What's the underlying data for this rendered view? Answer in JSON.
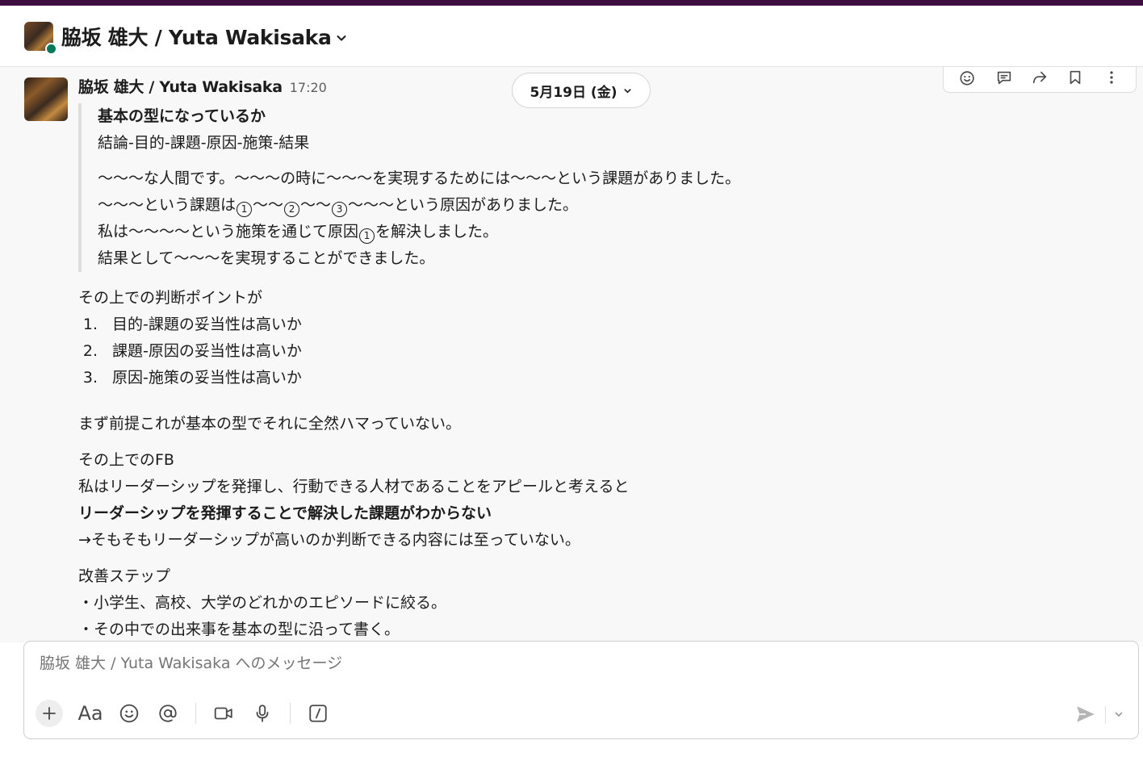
{
  "header": {
    "title": "脇坂 雄大 / Yuta Wakisaka"
  },
  "message": {
    "author": "脇坂 雄大 / Yuta Wakisaka",
    "time": "17:20",
    "quote": {
      "title": "基本の型になっているか",
      "structure": "結論-目的-課題-原因-施策-結果",
      "line1": "〜〜〜な人間です。〜〜〜の時に〜〜〜を実現するためには〜〜〜という課題がありました。",
      "line2_a": "〜〜〜という課題は",
      "line2_c1": "1",
      "line2_b": "〜〜",
      "line2_c2": "2",
      "line2_d": "〜〜",
      "line2_c3": "3",
      "line2_e": "〜〜〜という原因がありました。",
      "line3_a": "私は〜〜〜〜という施策を通じて原因",
      "line3_c1": "1",
      "line3_b": "を解決しました。",
      "line4": "結果として〜〜〜を実現することができました。"
    },
    "points_intro": "その上での判断ポイントが",
    "points": [
      {
        "num": "1.",
        "text": "目的-課題の妥当性は高いか"
      },
      {
        "num": "2.",
        "text": "課題-原因の妥当性は高いか"
      },
      {
        "num": "3.",
        "text": "原因-施策の妥当性は高いか"
      }
    ],
    "premise": "まず前提これが基本の型でそれに全然ハマっていない。",
    "fb_heading": "その上でのFB",
    "fb_line1": "私はリーダーシップを発揮し、行動できる人材であることをアピールと考えると",
    "fb_line2_bold": "リーダーシップを発揮することで解決した課題がわからない",
    "fb_line3": "→そもそもリーダーシップが高いのか判断できる内容には至っていない。",
    "steps_heading": "改善ステップ",
    "steps": [
      "・小学生、高校、大学のどれかのエピソードに絞る。",
      "・その中での出来事を基本の型に沿って書く。"
    ]
  },
  "date_divider": {
    "label": "5月19日 (金)"
  },
  "composer": {
    "placeholder": "脇坂 雄大 / Yuta Wakisaka へのメッセージ",
    "format_label": "Aa"
  },
  "colors": {
    "topbar": "#3f0e40",
    "presence": "#007a5a",
    "text": "#1d1c1d",
    "muted": "#616061"
  }
}
